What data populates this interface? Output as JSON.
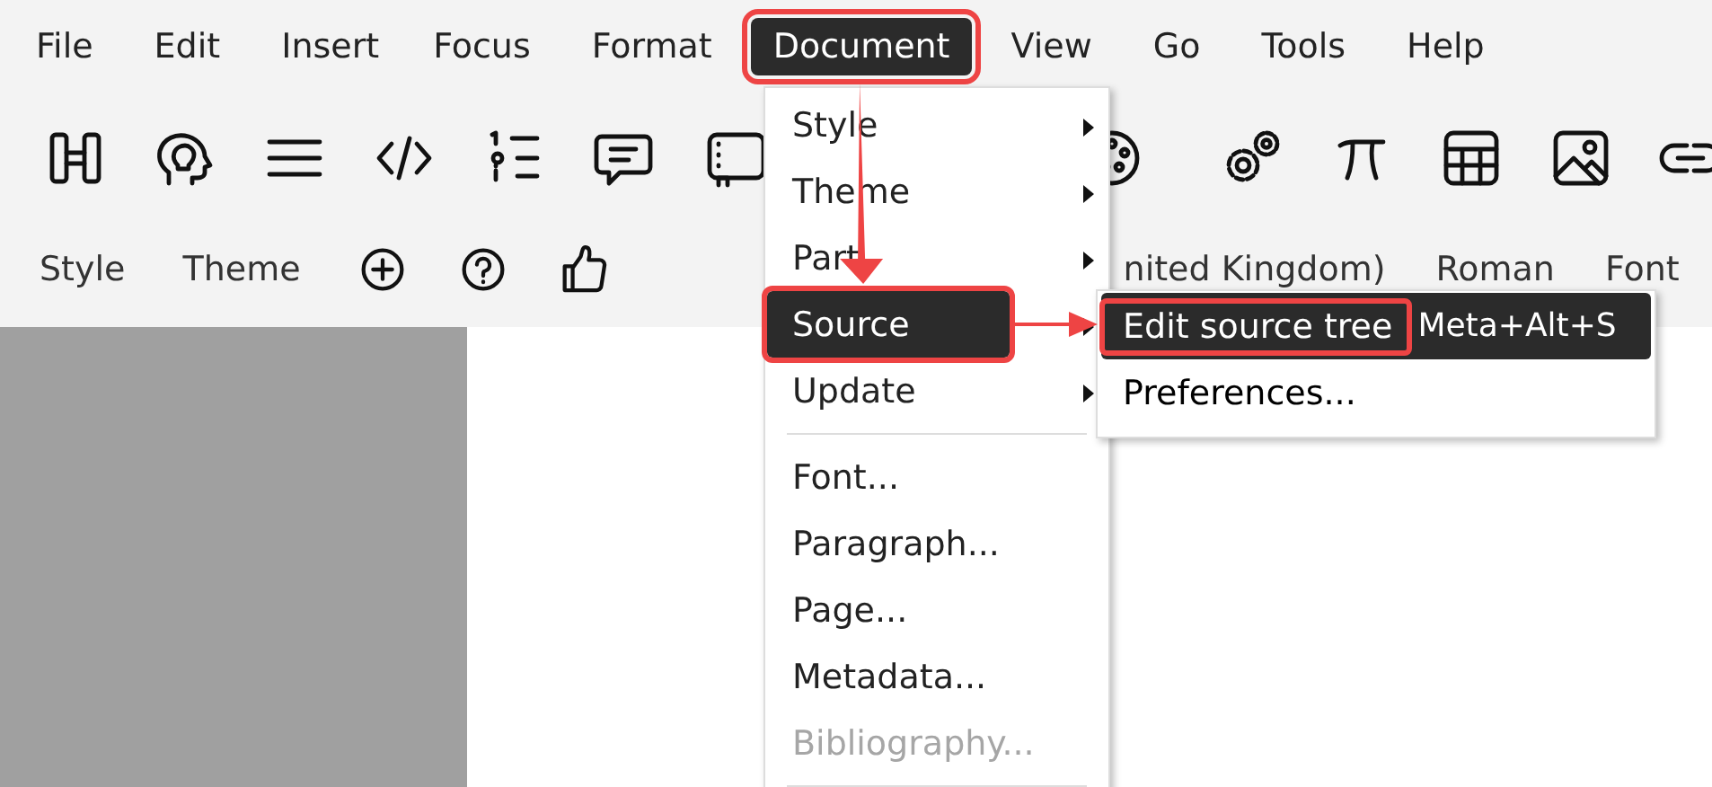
{
  "menu_bar": [
    {
      "label": "File",
      "selected": false
    },
    {
      "label": "Edit",
      "selected": false
    },
    {
      "label": "Insert",
      "selected": false
    },
    {
      "label": "Focus",
      "selected": false
    },
    {
      "label": "Format",
      "selected": false
    },
    {
      "label": "Document",
      "selected": true,
      "highlighted": true
    },
    {
      "label": "View",
      "selected": false
    },
    {
      "label": "Go",
      "selected": false
    },
    {
      "label": "Tools",
      "selected": false
    },
    {
      "label": "Help",
      "selected": false
    }
  ],
  "format_bar": {
    "left_labels": [
      "Style",
      "Theme"
    ],
    "right_labels": [
      "nited Kingdom)",
      "Roman",
      "Font"
    ]
  },
  "document_menu": [
    {
      "kind": "item",
      "label": "Style",
      "submenu": true,
      "selected": false,
      "disabled": false
    },
    {
      "kind": "item",
      "label": "Theme",
      "submenu": true,
      "selected": false,
      "disabled": false
    },
    {
      "kind": "item",
      "label": "Part",
      "submenu": true,
      "selected": false,
      "disabled": false
    },
    {
      "kind": "item",
      "label": "Source",
      "submenu": true,
      "selected": true,
      "highlighted": true,
      "disabled": false
    },
    {
      "kind": "item",
      "label": "Update",
      "submenu": true,
      "selected": false,
      "disabled": false
    },
    {
      "kind": "separator"
    },
    {
      "kind": "item",
      "label": "Font...",
      "submenu": false,
      "selected": false,
      "disabled": false
    },
    {
      "kind": "item",
      "label": "Paragraph...",
      "submenu": false,
      "selected": false,
      "disabled": false
    },
    {
      "kind": "item",
      "label": "Page...",
      "submenu": false,
      "selected": false,
      "disabled": false
    },
    {
      "kind": "item",
      "label": "Metadata...",
      "submenu": false,
      "selected": false,
      "disabled": false
    },
    {
      "kind": "item",
      "label": "Bibliography...",
      "submenu": false,
      "selected": false,
      "disabled": true
    },
    {
      "kind": "separator"
    }
  ],
  "source_submenu": [
    {
      "label": "Edit source tree",
      "shortcut": "Meta+Alt+S",
      "selected": true,
      "highlighted": true
    },
    {
      "label": "Preferences...",
      "selected": false,
      "highlighted": false
    }
  ]
}
